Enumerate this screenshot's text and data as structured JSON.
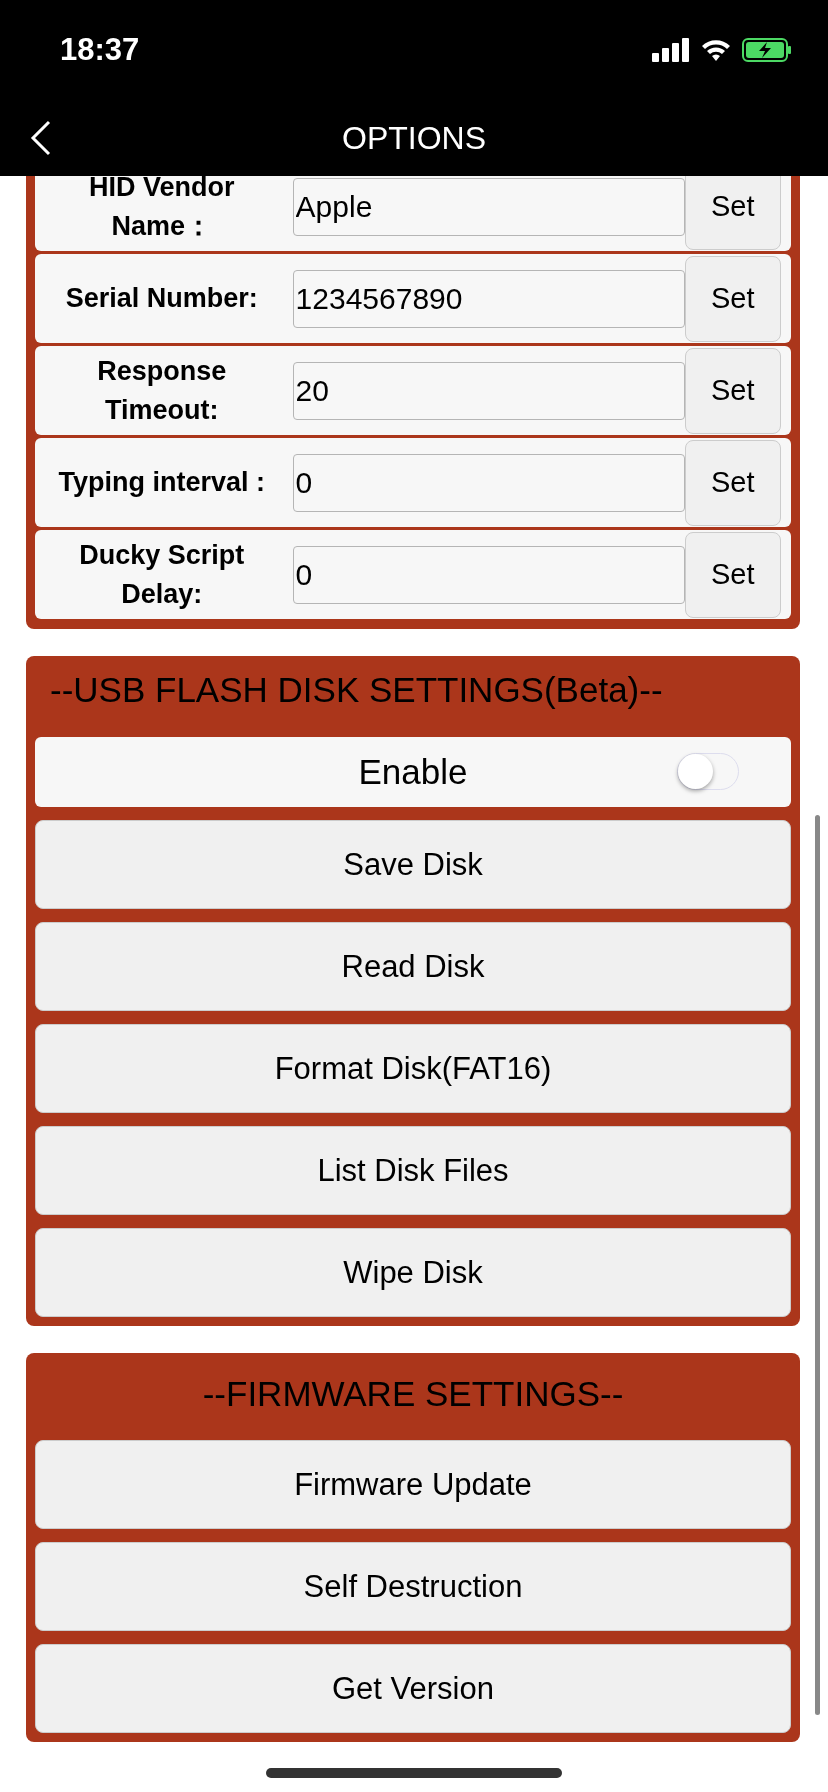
{
  "status_bar": {
    "time": "18:37"
  },
  "nav": {
    "title": "OPTIONS"
  },
  "hid_settings": {
    "rows": [
      {
        "label": "HID Vendor Name：",
        "value": "Apple",
        "button": "Set"
      },
      {
        "label": "Serial Number:",
        "value": "1234567890",
        "button": "Set"
      },
      {
        "label": "Response Timeout:",
        "value": "20",
        "button": "Set"
      },
      {
        "label": "Typing interval :",
        "value": "0",
        "button": "Set"
      },
      {
        "label": "Ducky Script Delay:",
        "value": "0",
        "button": "Set"
      }
    ]
  },
  "usb_disk": {
    "title": "--USB FLASH DISK SETTINGS(Beta)--",
    "toggle": {
      "label": "Enable",
      "on": false
    },
    "buttons": [
      "Save Disk",
      "Read Disk",
      "Format Disk(FAT16)",
      "List Disk Files",
      "Wipe Disk"
    ]
  },
  "firmware": {
    "title": "--FIRMWARE SETTINGS--",
    "buttons": [
      "Firmware Update",
      "Self Destruction",
      "Get Version"
    ]
  }
}
